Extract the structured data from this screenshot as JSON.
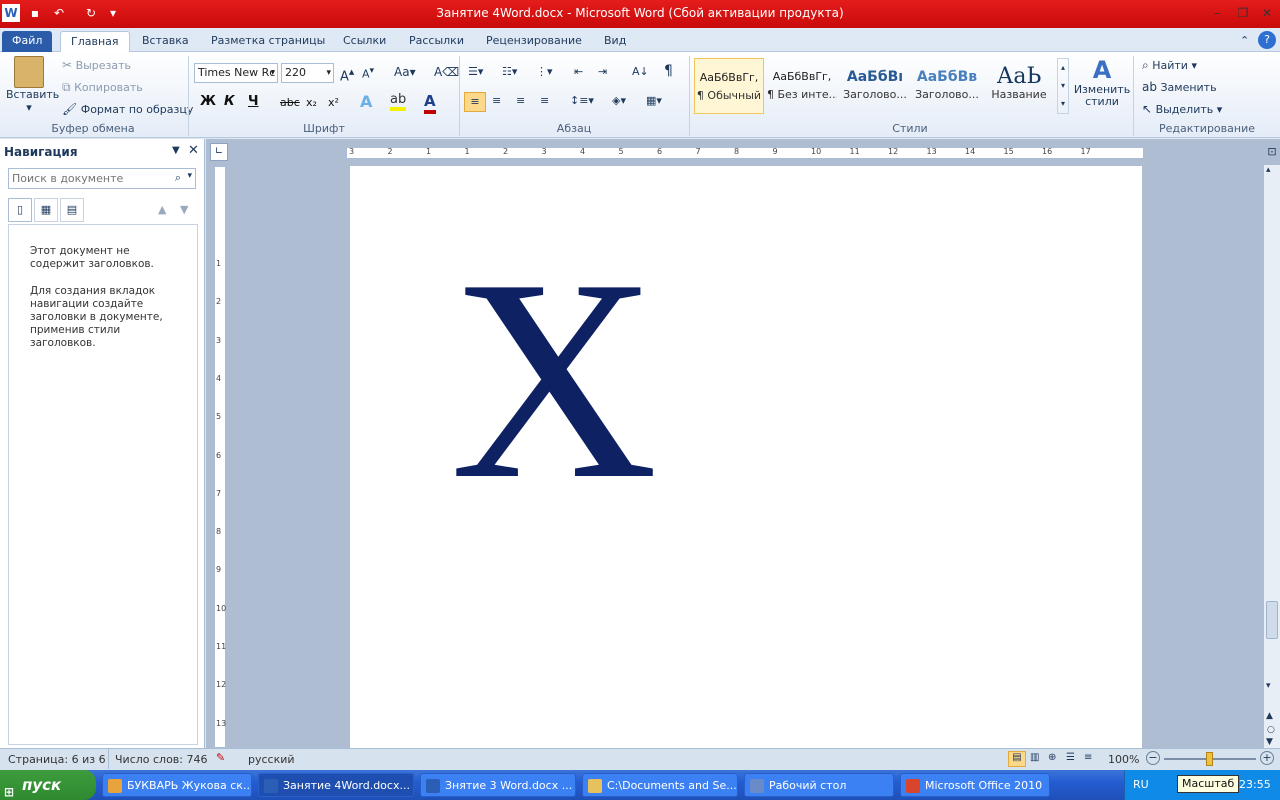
{
  "window": {
    "title": "Занятие 4Word.docx  -  Microsoft Word (Сбой активации продукта)"
  },
  "quick_access": {
    "undo": "↶",
    "redo": "↻"
  },
  "tabs": [
    {
      "label": "Файл"
    },
    {
      "label": "Главная"
    },
    {
      "label": "Вставка"
    },
    {
      "label": "Разметка страницы"
    },
    {
      "label": "Ссылки"
    },
    {
      "label": "Рассылки"
    },
    {
      "label": "Рецензирование"
    },
    {
      "label": "Вид"
    }
  ],
  "clipboard": {
    "paste": "Вставить",
    "cut": "Вырезать",
    "copy": "Копировать",
    "format_painter": "Формат по образцу",
    "group": "Буфер обмена"
  },
  "font": {
    "name": "Times New Rc",
    "size": "220",
    "group": "Шрифт",
    "bold": "Ж",
    "italic": "К",
    "underline": "Ч",
    "strike": "abc",
    "sub": "x₂",
    "sup": "x²"
  },
  "paragraph": {
    "group": "Абзац"
  },
  "styles": {
    "group": "Стили",
    "items": [
      {
        "preview": "АаБбВвГг,",
        "name": "¶ Обычный"
      },
      {
        "preview": "АаБбВвГг,",
        "name": "¶ Без инте..."
      },
      {
        "preview": "АаБбВı",
        "name": "Заголово..."
      },
      {
        "preview": "АаБбВв",
        "name": "Заголово..."
      },
      {
        "preview": "АаЬ",
        "name": "Название"
      }
    ],
    "change": "Изменить стили"
  },
  "editing": {
    "group": "Редактирование",
    "find": "Найти",
    "replace": "Заменить",
    "select": "Выделить"
  },
  "nav": {
    "title": "Навигация",
    "search_placeholder": "Поиск в документе",
    "msg1": "Этот документ не содержит заголовков.",
    "msg2": "Для создания вкладок навигации создайте заголовки в документе, применив стили заголовков."
  },
  "ruler": {
    "h": [
      "3",
      "2",
      "1",
      "1",
      "2",
      "3",
      "4",
      "5",
      "6",
      "7",
      "8",
      "9",
      "10",
      "11",
      "12",
      "13",
      "14",
      "15",
      "16",
      "17"
    ],
    "v": [
      "1",
      "2",
      "3",
      "4",
      "5",
      "6",
      "7",
      "8",
      "9",
      "10",
      "11",
      "12",
      "13"
    ]
  },
  "document": {
    "glyph": "X",
    "color": "#0e2263"
  },
  "status": {
    "page": "Страница: 6 из 6",
    "words": "Число слов: 746",
    "lang": "русский",
    "zoom": "100%"
  },
  "taskbar": {
    "start": "пуск",
    "items": [
      {
        "label": "БУКВАРЬ Жукова ск...",
        "color": "#e8a33c"
      },
      {
        "label": "Занятие 4Word.docx...",
        "color": "#2b5fb5"
      },
      {
        "label": "Знятие 3 Word.docx ...",
        "color": "#2b5fb5"
      },
      {
        "label": "C:\\Documents and Se...",
        "color": "#e7c15d"
      },
      {
        "label": "Рабочий стол",
        "color": "#6a8bc7"
      },
      {
        "label": "Microsoft Office 2010",
        "color": "#d9442c"
      }
    ],
    "lang": "RU",
    "tooltip": "Масштаб",
    "time": "23:55"
  }
}
